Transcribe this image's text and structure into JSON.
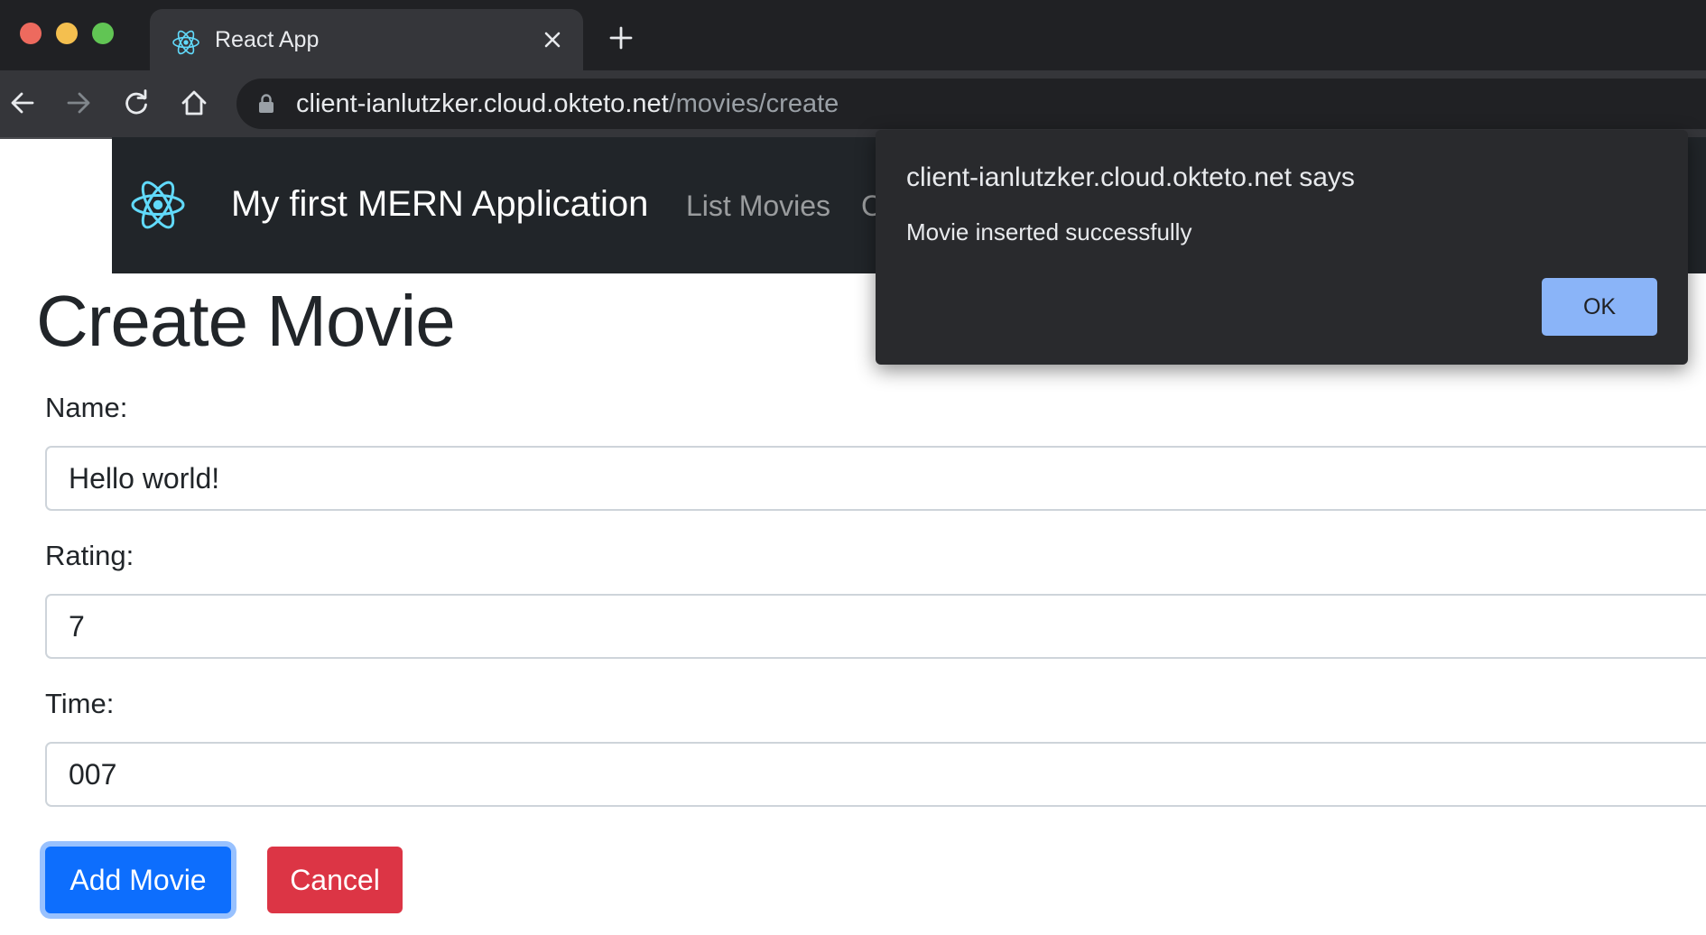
{
  "browser": {
    "tab_title": "React App",
    "url_host": "client-ianlutzker.cloud.okteto.net",
    "url_path": "/movies/create",
    "colors": {
      "react": "#61dafb",
      "chrome_dark": "#202124"
    }
  },
  "navbar": {
    "brand": "My first MERN Application",
    "links": [
      "List Movies",
      "C"
    ]
  },
  "page": {
    "title": "Create Movie",
    "fields": [
      {
        "label": "Name:",
        "value": "Hello world!"
      },
      {
        "label": "Rating:",
        "value": "7"
      },
      {
        "label": "Time:",
        "value": "007"
      }
    ],
    "buttons": {
      "add": "Add Movie",
      "cancel": "Cancel"
    },
    "colors": {
      "primary": "#0d6efd",
      "danger": "#dc3545"
    }
  },
  "dialog": {
    "title": "client-ianlutzker.cloud.okteto.net says",
    "message": "Movie inserted successfully",
    "ok_label": "OK"
  }
}
